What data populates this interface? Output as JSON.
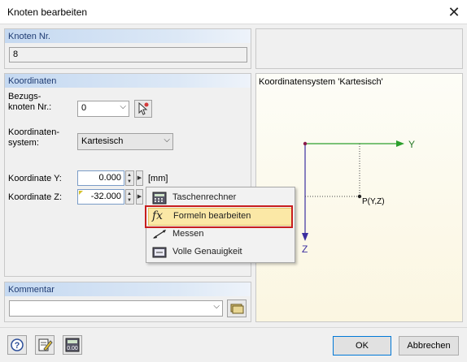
{
  "window": {
    "title": "Knoten bearbeiten"
  },
  "node_group": {
    "title": "Knoten Nr.",
    "value": "8"
  },
  "coord_group": {
    "title": "Koordinaten",
    "ref_label_line1": "Bezugs-",
    "ref_label_line2": "knoten Nr.:",
    "ref_value": "0",
    "system_label_line1": "Koordinaten-",
    "system_label_line2": "system:",
    "system_value": "Kartesisch",
    "y_label": "Koordinate Y:",
    "y_value": "0.000",
    "z_label": "Koordinate Z:",
    "z_value": "-32.000",
    "unit": "[mm]"
  },
  "context_menu": {
    "items": [
      {
        "label": "Taschenrechner",
        "icon": "calculator-icon"
      },
      {
        "label": "Formeln bearbeiten",
        "icon": "formula-fx-icon"
      },
      {
        "label": "Messen",
        "icon": "measure-icon"
      },
      {
        "label": "Volle Genauigkeit",
        "icon": "full-precision-icon"
      }
    ],
    "highlighted_index": 1
  },
  "comment_group": {
    "title": "Kommentar",
    "value": ""
  },
  "preview": {
    "caption": "Koordinatensystem 'Kartesisch'",
    "y_axis_label": "Y",
    "z_axis_label": "Z",
    "point_label": "P(Y,Z)",
    "y_axis_color": "#2ca02c",
    "z_axis_color": "#3b2ea0",
    "origin_color": "#8b1a4a"
  },
  "footer": {
    "ok_label": "OK",
    "cancel_label": "Abbrechen"
  },
  "colors": {
    "highlight": "#fbe8a6",
    "focus_frame": "#c81e1e",
    "group_header_text": "#1f3c73"
  }
}
